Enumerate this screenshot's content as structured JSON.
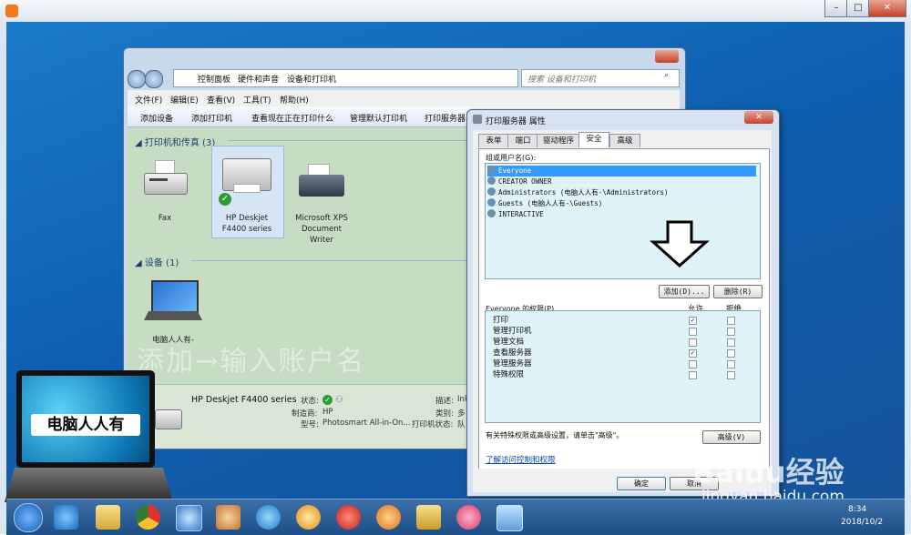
{
  "outer_window": {
    "controls": {
      "min": "–",
      "max": "□",
      "close": "✕"
    }
  },
  "explorer": {
    "breadcrumb": [
      "控制面板",
      "硬件和声音",
      "设备和打印机"
    ],
    "search_placeholder": "搜索 设备和打印机",
    "menu": [
      "文件(F)",
      "编辑(E)",
      "查看(V)",
      "工具(T)",
      "帮助(H)"
    ],
    "commands": [
      "添加设备",
      "添加打印机",
      "查看现在正在打印什么",
      "管理默认打印机",
      "打印服务器"
    ],
    "printers_section": "打印机和传真 (3)",
    "printers": [
      {
        "line1": "Fax",
        "line2": "",
        "line3": ""
      },
      {
        "line1": "HP Deskjet",
        "line2": "F4400 series",
        "line3": ""
      },
      {
        "line1": "Microsoft XPS",
        "line2": "Document",
        "line3": "Writer"
      }
    ],
    "devices_section": "设备 (1)",
    "devices": [
      {
        "label": "电脑人人有-"
      }
    ],
    "details": {
      "name": "HP Deskjet F4400 series",
      "status_label": "状态:",
      "maker_label": "制造商:",
      "maker_value": "HP",
      "model_label": "型号:",
      "model_value": "Photosmart All-in-On...",
      "desc_label": "描述:",
      "desc_value": "Ink",
      "cat_label": "类别:",
      "cat_value": "多",
      "pstatus_label": "打印机状态:",
      "pstatus_value": "队"
    }
  },
  "overlay_caption": "添加→输入账户名",
  "dialog": {
    "title": "打印服务器 属性",
    "tabs": [
      "表单",
      "端口",
      "驱动程序",
      "安全",
      "高级"
    ],
    "selected_tab": "安全",
    "groups_label": "组或用户名(G):",
    "users": [
      "Everyone",
      "CREATOR OWNER",
      "Administrators (电脑人人有-\\Administrators)",
      "Guests (电脑人人有-\\Guests)",
      "INTERACTIVE"
    ],
    "add_button": "添加(D)...",
    "remove_button": "删除(R)",
    "perms_label": "Everyone 的权限(P)",
    "allow_label": "允许",
    "deny_label": "拒绝",
    "permissions": [
      {
        "name": "打印",
        "allow": true,
        "deny": false
      },
      {
        "name": "管理打印机",
        "allow": false,
        "deny": false
      },
      {
        "name": "管理文档",
        "allow": false,
        "deny": false
      },
      {
        "name": "查看服务器",
        "allow": true,
        "deny": false
      },
      {
        "name": "管理服务器",
        "allow": false,
        "deny": false
      },
      {
        "name": "特殊权限",
        "allow": false,
        "deny": false
      }
    ],
    "advanced_note": "有关特殊权限或高级设置，请单击\"高级\"。",
    "advanced_button": "高级(V)",
    "help_link": "了解访问控制和权限",
    "ok_button": "确定",
    "cancel_button": "取消"
  },
  "laptop_logo": {
    "text": "电脑人人有"
  },
  "watermark": {
    "logo": "Baidu经验",
    "url": "jingyan.baidu.com"
  },
  "taskbar": {
    "time": "8:34",
    "date": "2018/10/2"
  }
}
